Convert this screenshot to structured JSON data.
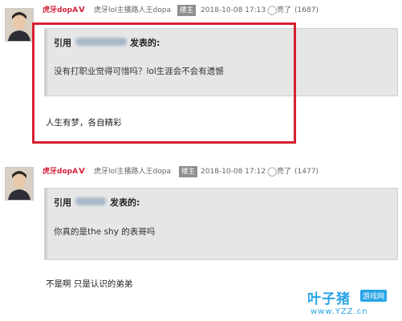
{
  "posts": [
    {
      "username": "虎牙dopA",
      "verified_mark": "V",
      "user_title": "虎牙lol主播路人王dopa",
      "badge": "楼主",
      "timestamp": "2018-10-08 17:13",
      "like_label": "亮了",
      "like_count": "(1687)",
      "quote_prefix": "引用",
      "quote_suffix": "发表的:",
      "quote_text": "没有打职业觉得可惜吗？lol生涯会不会有遗憾",
      "reply": "人生有梦，各自精彩"
    },
    {
      "username": "虎牙dopA",
      "verified_mark": "V",
      "user_title": "虎牙lol主播路人王dopa",
      "badge": "楼主",
      "timestamp": "2018-10-08 17:12",
      "like_label": "亮了",
      "like_count": "(1477)",
      "quote_prefix": "引用",
      "quote_suffix": "发表的:",
      "quote_text": "你真的是the shy 的表哥吗",
      "reply": "不是啊 只是认识的弟弟"
    }
  ],
  "watermark": {
    "brand": "叶子猪",
    "tag": "游戏网",
    "url": "www.YZZ.cn"
  },
  "colors": {
    "username": "#d3243c",
    "highlight": "#d6212f",
    "quote_bg": "#e6e6e6",
    "watermark": "#29a4e6"
  },
  "icons": [
    "avatar",
    "verified-icon",
    "light-bulb-icon"
  ]
}
